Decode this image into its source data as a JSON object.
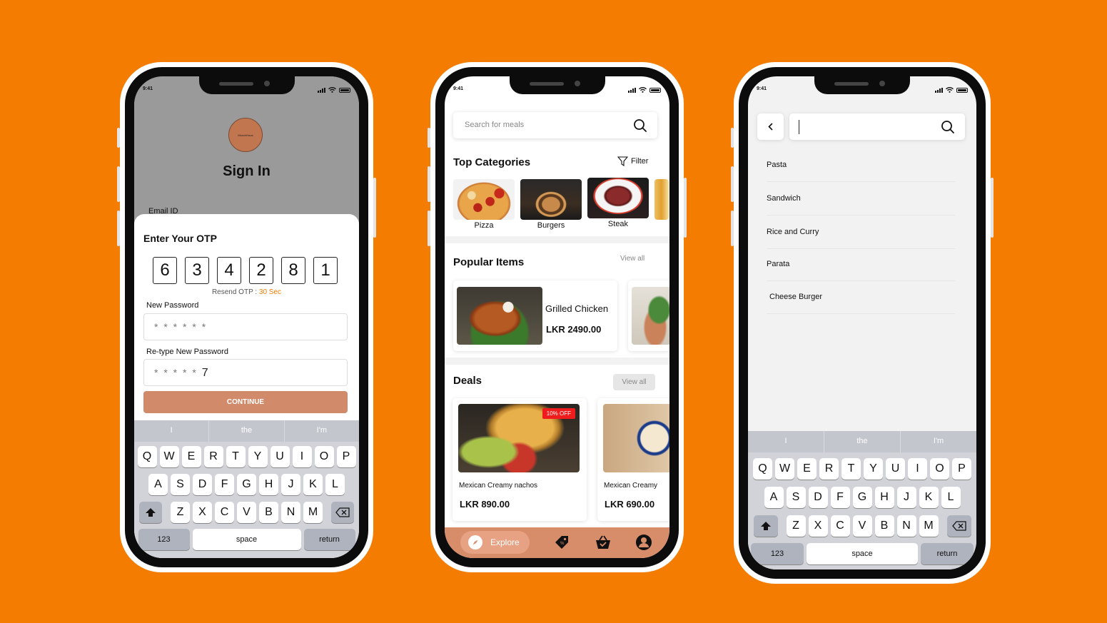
{
  "status": {
    "time": "9:41"
  },
  "phone1": {
    "logo_text": "MunchHaus",
    "title": "Sign In",
    "email_label": "Email ID",
    "otp_title": "Enter Your OTP",
    "otp_digits": [
      "6",
      "3",
      "4",
      "2",
      "8",
      "1"
    ],
    "resend_label": "Resend OTP : ",
    "resend_countdown": "30 Sec",
    "new_password_label": "New Password",
    "new_password_value": "* * * * * *",
    "retype_label": "Re-type New Password",
    "retype_masked": "* * * * *",
    "retype_typed": "7",
    "continue_label": "CONTINUE"
  },
  "keyboard": {
    "suggestions": [
      "I",
      "the",
      "I'm"
    ],
    "row1": [
      "Q",
      "W",
      "E",
      "R",
      "T",
      "Y",
      "U",
      "I",
      "O",
      "P"
    ],
    "row2": [
      "A",
      "S",
      "D",
      "F",
      "G",
      "H",
      "J",
      "K",
      "L"
    ],
    "row3": [
      "Z",
      "X",
      "C",
      "V",
      "B",
      "N",
      "M"
    ],
    "numbers": "123",
    "space": "space",
    "return": "return"
  },
  "phone2": {
    "search_placeholder": "Search for meals",
    "top_categories_title": "Top Categories",
    "filter_label": "Filter",
    "categories": [
      "Pizza",
      "Burgers",
      "Steak"
    ],
    "popular_title": "Popular Items",
    "popular_view_all": "View all",
    "popular_items": [
      {
        "name": "Grilled Chicken",
        "price": "LKR 2490.00"
      }
    ],
    "deals_title": "Deals",
    "deals_view_all": "View all",
    "deals": [
      {
        "name": "Mexican Creamy nachos",
        "price": "LKR 890.00",
        "badge": "10% OFF"
      },
      {
        "name": "Mexican Creamy",
        "price": "LKR 690.00"
      }
    ],
    "tab_explore": "Explore"
  },
  "phone3": {
    "suggestions": [
      "Pasta",
      "Sandwich",
      "Rice and Curry",
      "Parata",
      "Cheese Burger"
    ]
  },
  "colors": {
    "background": "#f47c00",
    "accent": "#d88d6a",
    "badge": "#ee1c1c"
  }
}
